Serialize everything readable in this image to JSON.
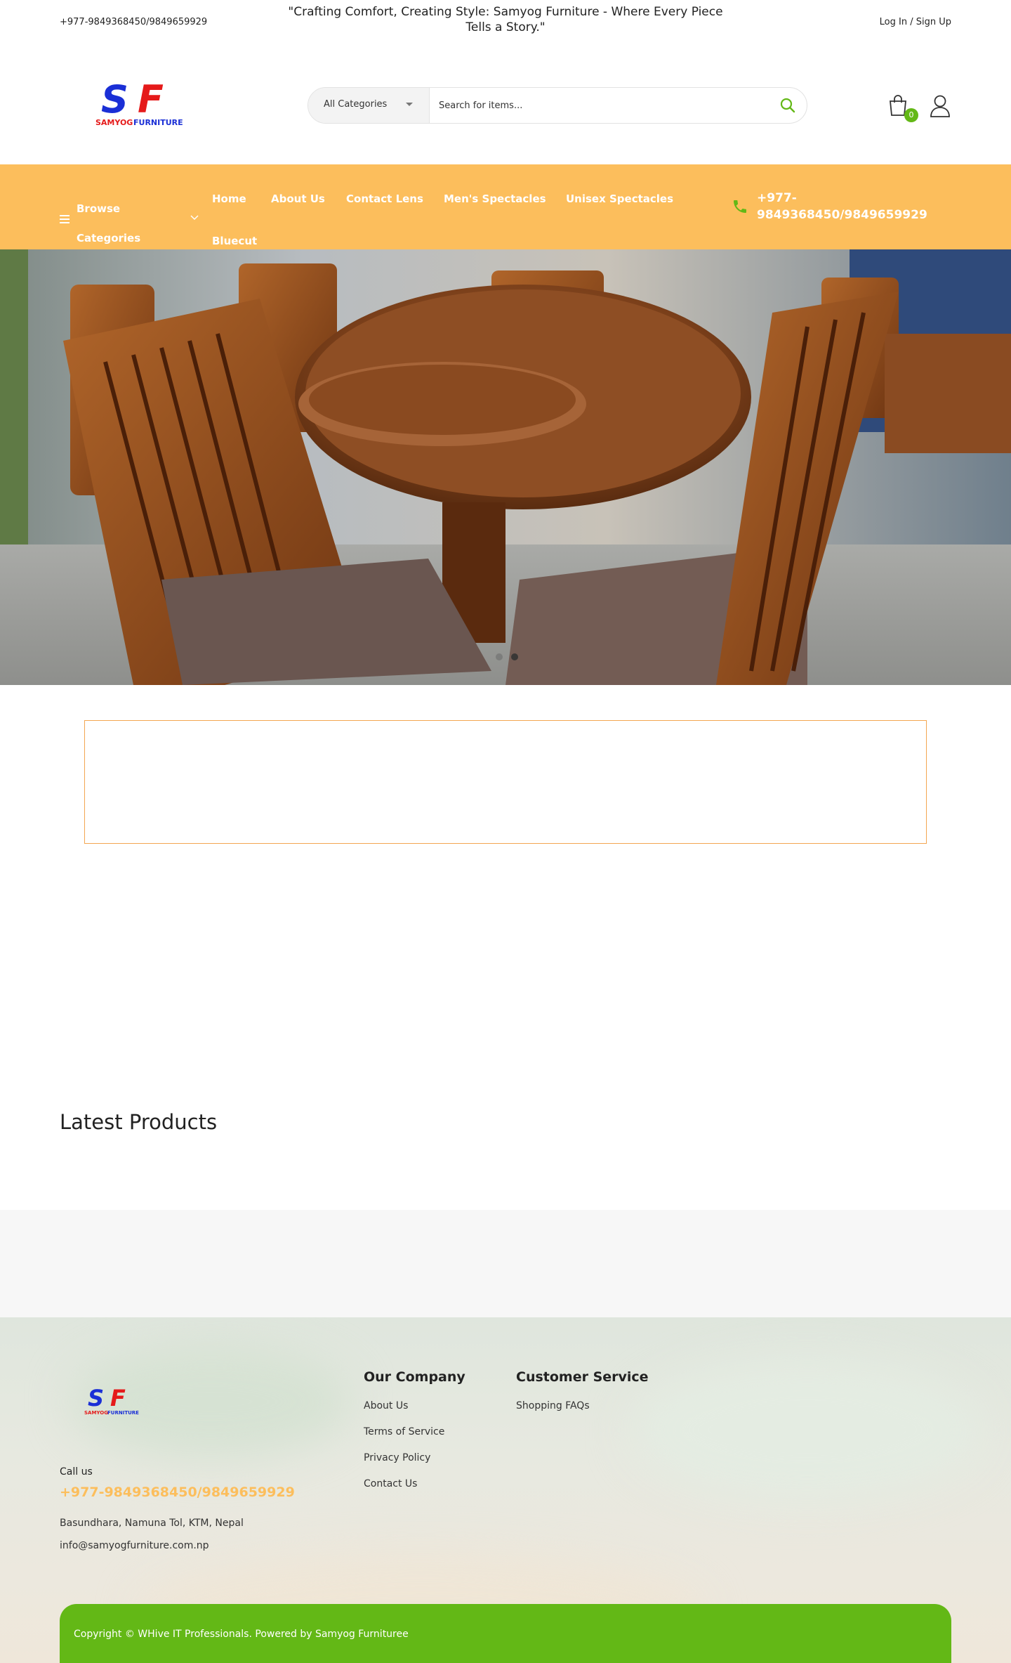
{
  "topbar": {
    "phone": "+977-9849368450/9849659929",
    "tagline": "\"Crafting Comfort, Creating Style: Samyog Furniture - Where Every Piece Tells a Story.\"",
    "login": "Log In / Sign Up"
  },
  "header": {
    "logo_letters": "SF",
    "logo_text": "SAMYOG FURNITURE",
    "category_select": "All Categories",
    "search_placeholder": "Search for items...",
    "cart_count": "0"
  },
  "nav": {
    "browse_label": "Browse Categories",
    "items": [
      {
        "label": "Home"
      },
      {
        "label": "About Us"
      },
      {
        "label": "Contact Lens"
      },
      {
        "label": "Men's Spectacles"
      },
      {
        "label": "Unisex Spectacles"
      },
      {
        "label": "Bluecut"
      }
    ],
    "phone": "+977-9849368450/9849659929"
  },
  "hero": {
    "slide_count": 2,
    "active_slide": 2
  },
  "sections": {
    "latest_products": "Latest Products"
  },
  "footer": {
    "call_label": "Call us",
    "phone": "+977-9849368450/9849659929",
    "address": "Basundhara, Namuna Tol, KTM, Nepal",
    "email": "info@samyogfurniture.com.np",
    "company_title": "Our Company",
    "company_links": [
      {
        "label": "About Us"
      },
      {
        "label": "Terms of Service"
      },
      {
        "label": "Privacy Policy"
      },
      {
        "label": "Contact Us"
      }
    ],
    "service_title": "Customer Service",
    "service_links": [
      {
        "label": "Shopping FAQs"
      }
    ],
    "copyright": "Copyright © WHive IT Professionals. Powered by Samyog Furnituree"
  },
  "colors": {
    "accent_orange": "#fcbe5c",
    "accent_green": "#63b816",
    "logo_blue": "#1a2fd6",
    "logo_red": "#e51a1a"
  }
}
